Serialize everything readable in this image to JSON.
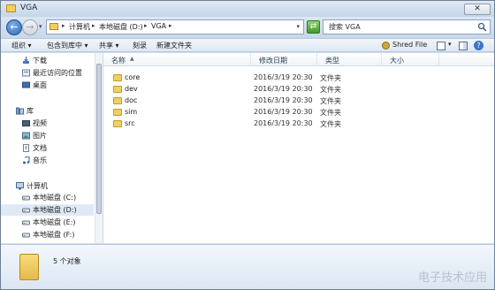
{
  "window": {
    "title": "VGA",
    "close_glyph": "✕"
  },
  "nav_buttons": {
    "back_glyph": "←",
    "forward_glyph": "→",
    "refresh_glyph": "⇄"
  },
  "address": {
    "crumbs": [
      "计算机",
      "本地磁盘 (D:)",
      "VGA"
    ],
    "sep": "▸",
    "dropdown": "▾"
  },
  "search": {
    "placeholder": "搜索 VGA"
  },
  "toolbar": {
    "organize": "组织 ▾",
    "include_library": "包含到库中 ▾",
    "share": "共享 ▾",
    "burn": "刻录",
    "new_folder": "新建文件夹",
    "shred": "Shred File",
    "help": "?"
  },
  "navpane": {
    "items": [
      {
        "label": "下载",
        "icon": "download-icon"
      },
      {
        "label": "最近访问的位置",
        "icon": "recent-icon"
      },
      {
        "label": "桌面",
        "icon": "desktop-icon"
      },
      {
        "label": "库",
        "icon": "library-icon"
      },
      {
        "label": "视频",
        "icon": "video-icon"
      },
      {
        "label": "图片",
        "icon": "picture-icon"
      },
      {
        "label": "文档",
        "icon": "document-icon"
      },
      {
        "label": "音乐",
        "icon": "music-icon"
      },
      {
        "label": "计算机",
        "icon": "computer-icon"
      },
      {
        "label": "本地磁盘 (C:)",
        "icon": "drive-icon"
      },
      {
        "label": "本地磁盘 (D:)",
        "icon": "drive-icon",
        "selected": true
      },
      {
        "label": "本地磁盘 (E:)",
        "icon": "drive-icon"
      },
      {
        "label": "本地磁盘 (F:)",
        "icon": "drive-icon"
      }
    ]
  },
  "columns": {
    "name": "名称",
    "date": "修改日期",
    "type": "类型",
    "size": "大小"
  },
  "files": [
    {
      "name": "core",
      "date": "2016/3/19 20:30",
      "type": "文件夹"
    },
    {
      "name": "dev",
      "date": "2016/3/19 20:30",
      "type": "文件夹"
    },
    {
      "name": "doc",
      "date": "2016/3/19 20:30",
      "type": "文件夹"
    },
    {
      "name": "sim",
      "date": "2016/3/19 20:30",
      "type": "文件夹"
    },
    {
      "name": "src",
      "date": "2016/3/19 20:30",
      "type": "文件夹"
    }
  ],
  "details": {
    "count_text": "5 个对象"
  },
  "watermark": "电子技术应用",
  "colors": {
    "folder": "#f2cf62",
    "selection": "#dfe9f6",
    "chrome": "#cfdceb"
  }
}
